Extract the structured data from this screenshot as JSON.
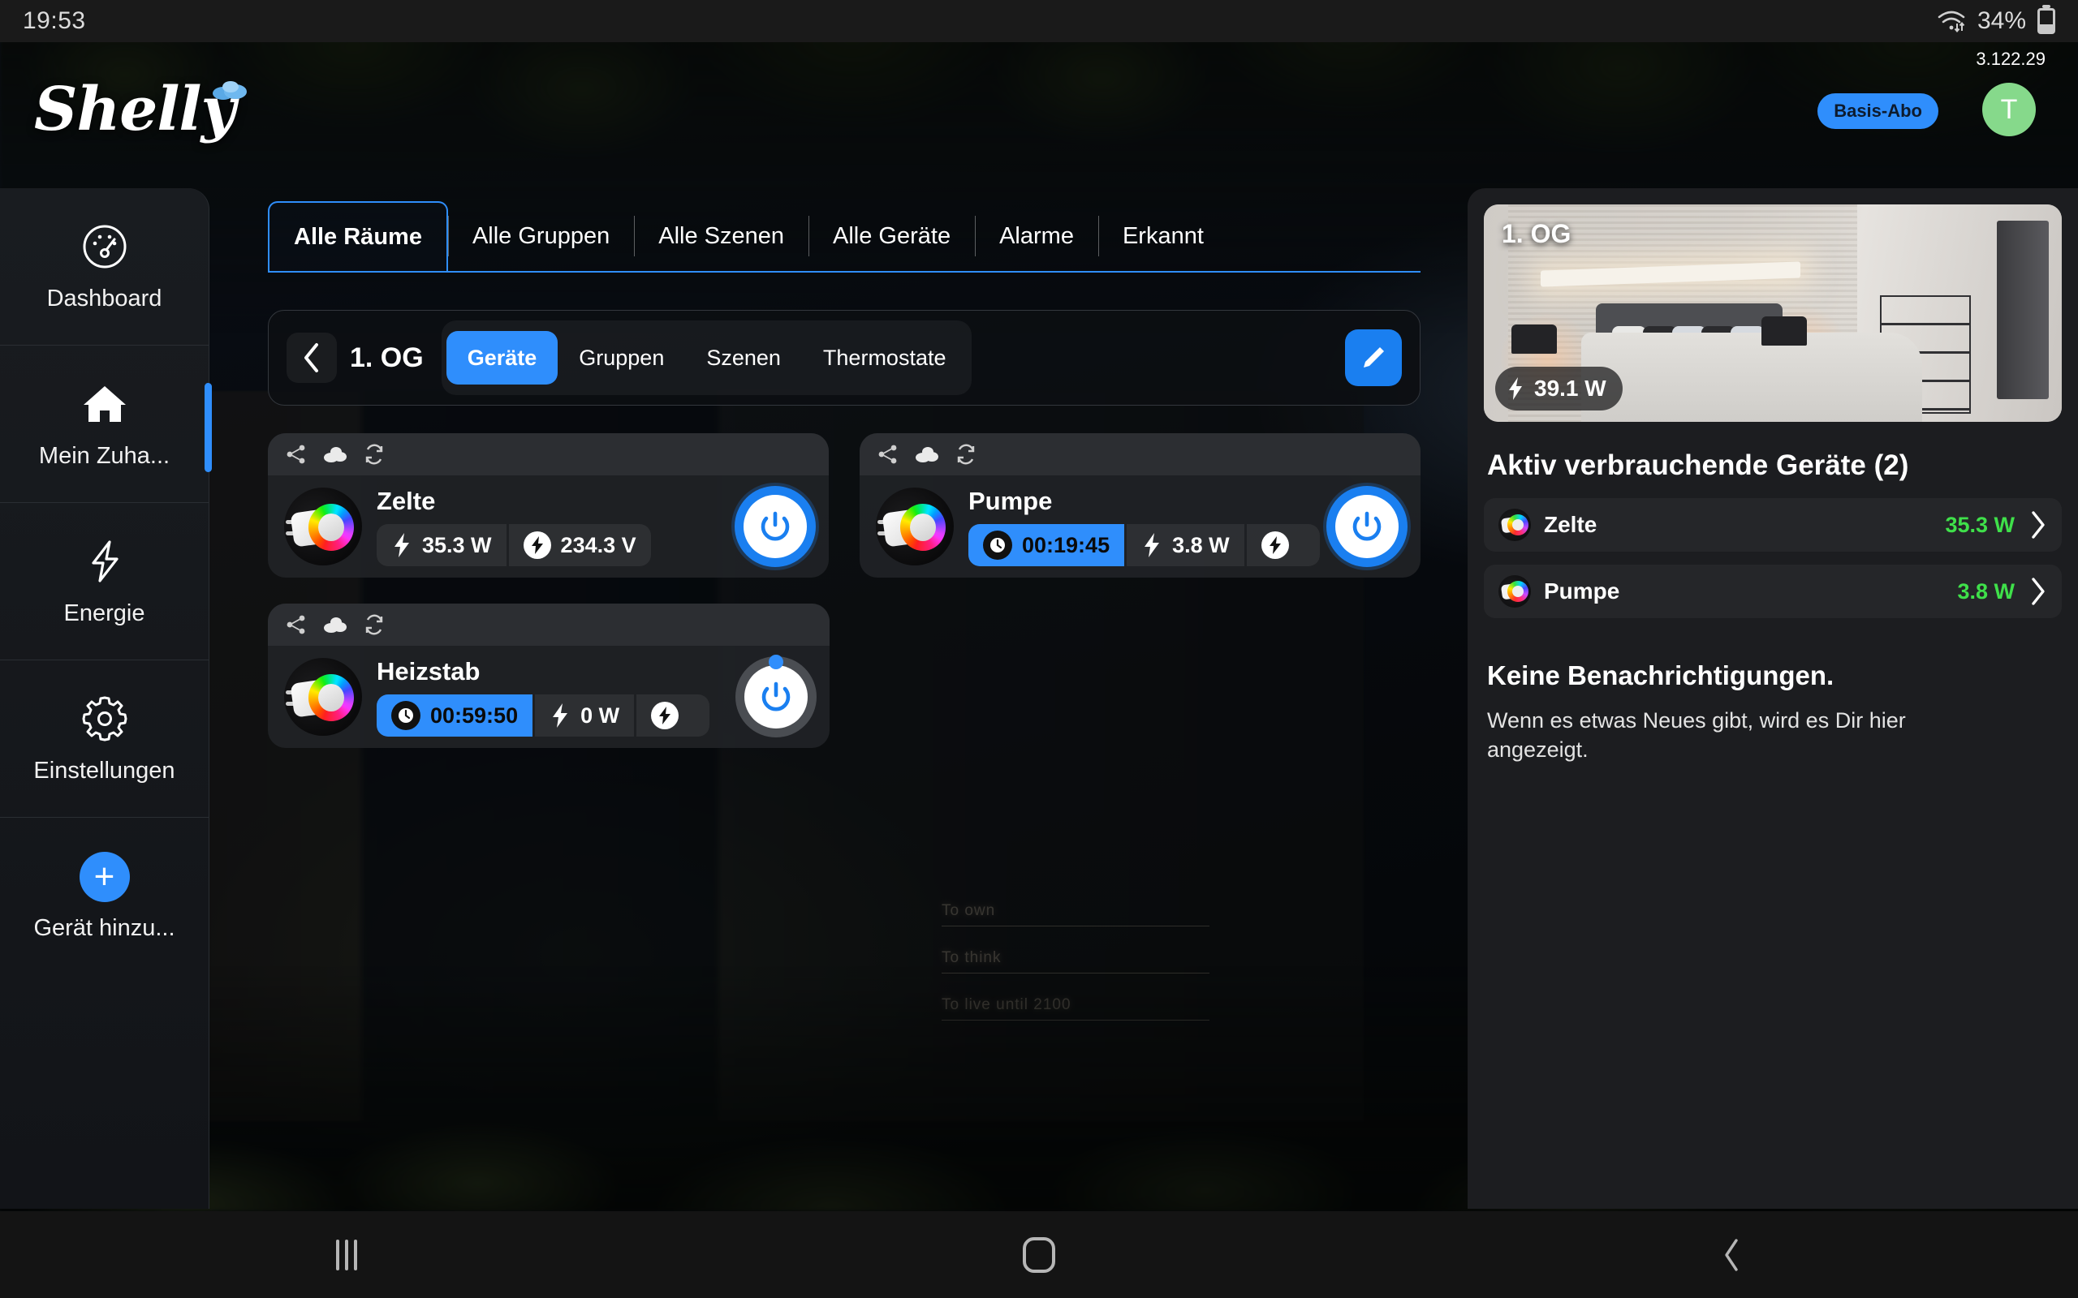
{
  "statusbar": {
    "time": "19:53",
    "battery_percent": "34%",
    "wifi_icon": "wifi-icon",
    "battery_icon": "battery-icon"
  },
  "header": {
    "logo_text": "Shelly",
    "logo_cloud_icon": "cloud-icon",
    "version": "3.122.29",
    "subscription_badge": "Basis-Abo",
    "avatar_initial": "T",
    "avatar_color": "#86d98b",
    "accent_color": "#2f8efc"
  },
  "sidebar": {
    "items": [
      {
        "label": "Dashboard",
        "icon": "dashboard-gauge-icon",
        "active": false
      },
      {
        "label": "Mein Zuha...",
        "icon": "home-icon",
        "active": true
      },
      {
        "label": "Energie",
        "icon": "lightning-icon",
        "active": false
      },
      {
        "label": "Einstellungen",
        "icon": "gear-icon",
        "active": false
      },
      {
        "label": "Gerät hinzu...",
        "icon": "plus-icon",
        "active": false
      }
    ]
  },
  "tabs": [
    {
      "label": "Alle Räume",
      "active": true
    },
    {
      "label": "Alle Gruppen",
      "active": false
    },
    {
      "label": "Alle Szenen",
      "active": false
    },
    {
      "label": "Alle Geräte",
      "active": false
    },
    {
      "label": "Alarme",
      "active": false
    },
    {
      "label": "Erkannt",
      "active": false
    }
  ],
  "roombar": {
    "back_icon": "chevron-left-icon",
    "room_name": "1. OG",
    "segments": [
      {
        "label": "Geräte",
        "active": true
      },
      {
        "label": "Gruppen",
        "active": false
      },
      {
        "label": "Szenen",
        "active": false
      },
      {
        "label": "Thermostate",
        "active": false
      }
    ],
    "edit_icon": "pencil-icon"
  },
  "devices": [
    {
      "name": "Zelte",
      "top_icons": [
        "share-icon",
        "cloud-icon",
        "refresh-icon"
      ],
      "timer": null,
      "power": "35.3 W",
      "voltage": "234.3 V",
      "state": "on",
      "device_image": "smart-plug-rgb"
    },
    {
      "name": "Pumpe",
      "top_icons": [
        "share-icon",
        "cloud-icon",
        "refresh-icon"
      ],
      "timer": "00:19:45",
      "power": "3.8 W",
      "voltage": "",
      "state": "on",
      "device_image": "smart-plug-rgb"
    },
    {
      "name": "Heizstab",
      "top_icons": [
        "share-icon",
        "cloud-icon",
        "refresh-icon"
      ],
      "timer": "00:59:50",
      "power": "0 W",
      "voltage": "",
      "state": "off",
      "device_image": "smart-plug-rgb"
    }
  ],
  "right_panel": {
    "room_card": {
      "label": "1. OG",
      "watt_badge": "39.1 W",
      "bolt_icon": "lightning-icon",
      "image": "bedroom-photo"
    },
    "active_devices_title": "Aktiv verbrauchende Geräte (2)",
    "active_devices": [
      {
        "name": "Zelte",
        "watt": "35.3 W",
        "chevron": "chevron-right-icon"
      },
      {
        "name": "Pumpe",
        "watt": "3.8 W",
        "chevron": "chevron-right-icon"
      }
    ],
    "watt_color": "#3fe04a",
    "notifications_title": "Keine Benachrichtigungen.",
    "notifications_body": "Wenn es etwas Neues gibt, wird es Dir hier angezeigt."
  },
  "navbar": {
    "recents_icon": "recents-icon",
    "home_icon": "home-square-icon",
    "back_icon": "chevron-left-icon"
  },
  "background": {
    "neon_lines": [
      "To own",
      "To think",
      "To live until 2100"
    ]
  }
}
